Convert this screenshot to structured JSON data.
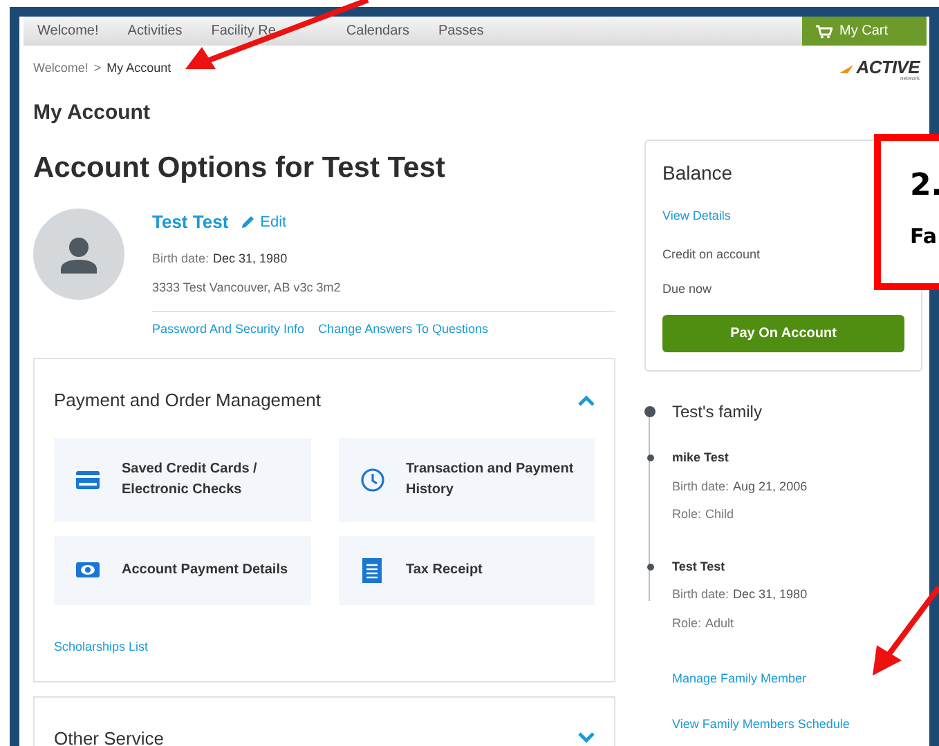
{
  "nav": {
    "items": [
      {
        "label": "Welcome!"
      },
      {
        "label": "Activities"
      },
      {
        "label": "Facility Re"
      },
      {
        "label": "Calendars"
      },
      {
        "label": "Passes"
      }
    ],
    "cart": "My Cart"
  },
  "breadcrumb": {
    "items": [
      "Welcome!",
      "My Account"
    ],
    "separator": ">"
  },
  "logo": {
    "text": "ACTIVE",
    "subtext": "network"
  },
  "page_title": "My Account",
  "account": {
    "heading": "Account Options for Test Test",
    "name": "Test Test",
    "edit": "Edit",
    "birth_label": "Birth date:",
    "birth_date": "Dec 31, 1980",
    "address": "3333 Test Vancouver, AB v3c 3m2",
    "links": [
      "Password And Security Info",
      "Change Answers To Questions"
    ]
  },
  "sections": [
    {
      "title": "Payment and Order Management",
      "expanded": true,
      "tiles": [
        {
          "label": "Saved Credit Cards / Electronic Checks"
        },
        {
          "label": "Transaction and Payment History"
        },
        {
          "label": "Account Payment Details"
        },
        {
          "label": "Tax Receipt"
        }
      ],
      "link": "Scholarships List"
    },
    {
      "title": "Other Service",
      "expanded": false
    }
  ],
  "balance": {
    "title": "Balance",
    "link": "View Details",
    "rows": [
      "Credit on account",
      "Due now"
    ],
    "button": "Pay On Account"
  },
  "family": {
    "title": "Test's family",
    "members": [
      {
        "name": "mike Test",
        "birth_label": "Birth date:",
        "birth_date": "Aug 21, 2006",
        "role_label": "Role:",
        "role": "Child"
      },
      {
        "name": "Test Test",
        "birth_label": "Birth date:",
        "birth_date": "Dec 31, 1980",
        "role_label": "Role:",
        "role": "Adult"
      }
    ],
    "links": [
      "Manage Family Member",
      "View Family Members Schedule"
    ]
  },
  "annotation": {
    "number": "2.",
    "text": "Fa"
  }
}
